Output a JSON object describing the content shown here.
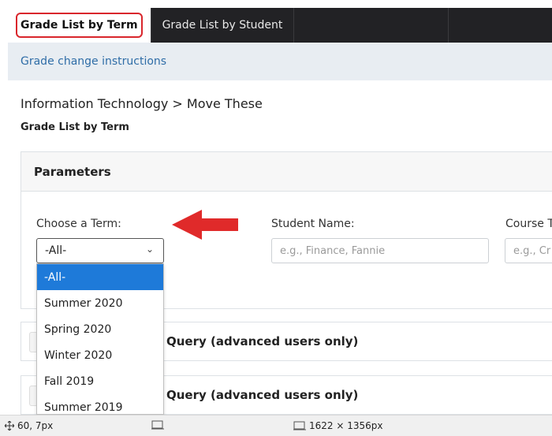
{
  "tabs": [
    {
      "label": "Grade List by Term",
      "active": true
    },
    {
      "label": "Grade List by Student",
      "active": false
    }
  ],
  "info_link": "Grade change instructions",
  "breadcrumb": "Information Technology > Move These",
  "subtitle": "Grade List by Term",
  "parameters": {
    "title": "Parameters",
    "term_label": "Choose a Term:",
    "term_value": "-All-",
    "student_label": "Student Name:",
    "student_placeholder": "e.g., Finance, Fannie",
    "course_label": "Course T",
    "course_placeholder": "e.g., Cr"
  },
  "dropdown_options": [
    "-All-",
    "Summer 2020",
    "Spring 2020",
    "Winter 2020",
    "Fall 2019",
    "Summer 2019"
  ],
  "collapsibles": [
    {
      "label": "Query (advanced users only)"
    },
    {
      "label": "Query (advanced users only)"
    }
  ],
  "statusbar": {
    "cursor": "60, 7px",
    "dimensions": "1622 × 1356px"
  },
  "colors": {
    "tabbar": "#222225",
    "highlight": "#d9262c",
    "arrow": "#e02a2a",
    "selected_option": "#1e7ad9",
    "link": "#2f6da7"
  }
}
